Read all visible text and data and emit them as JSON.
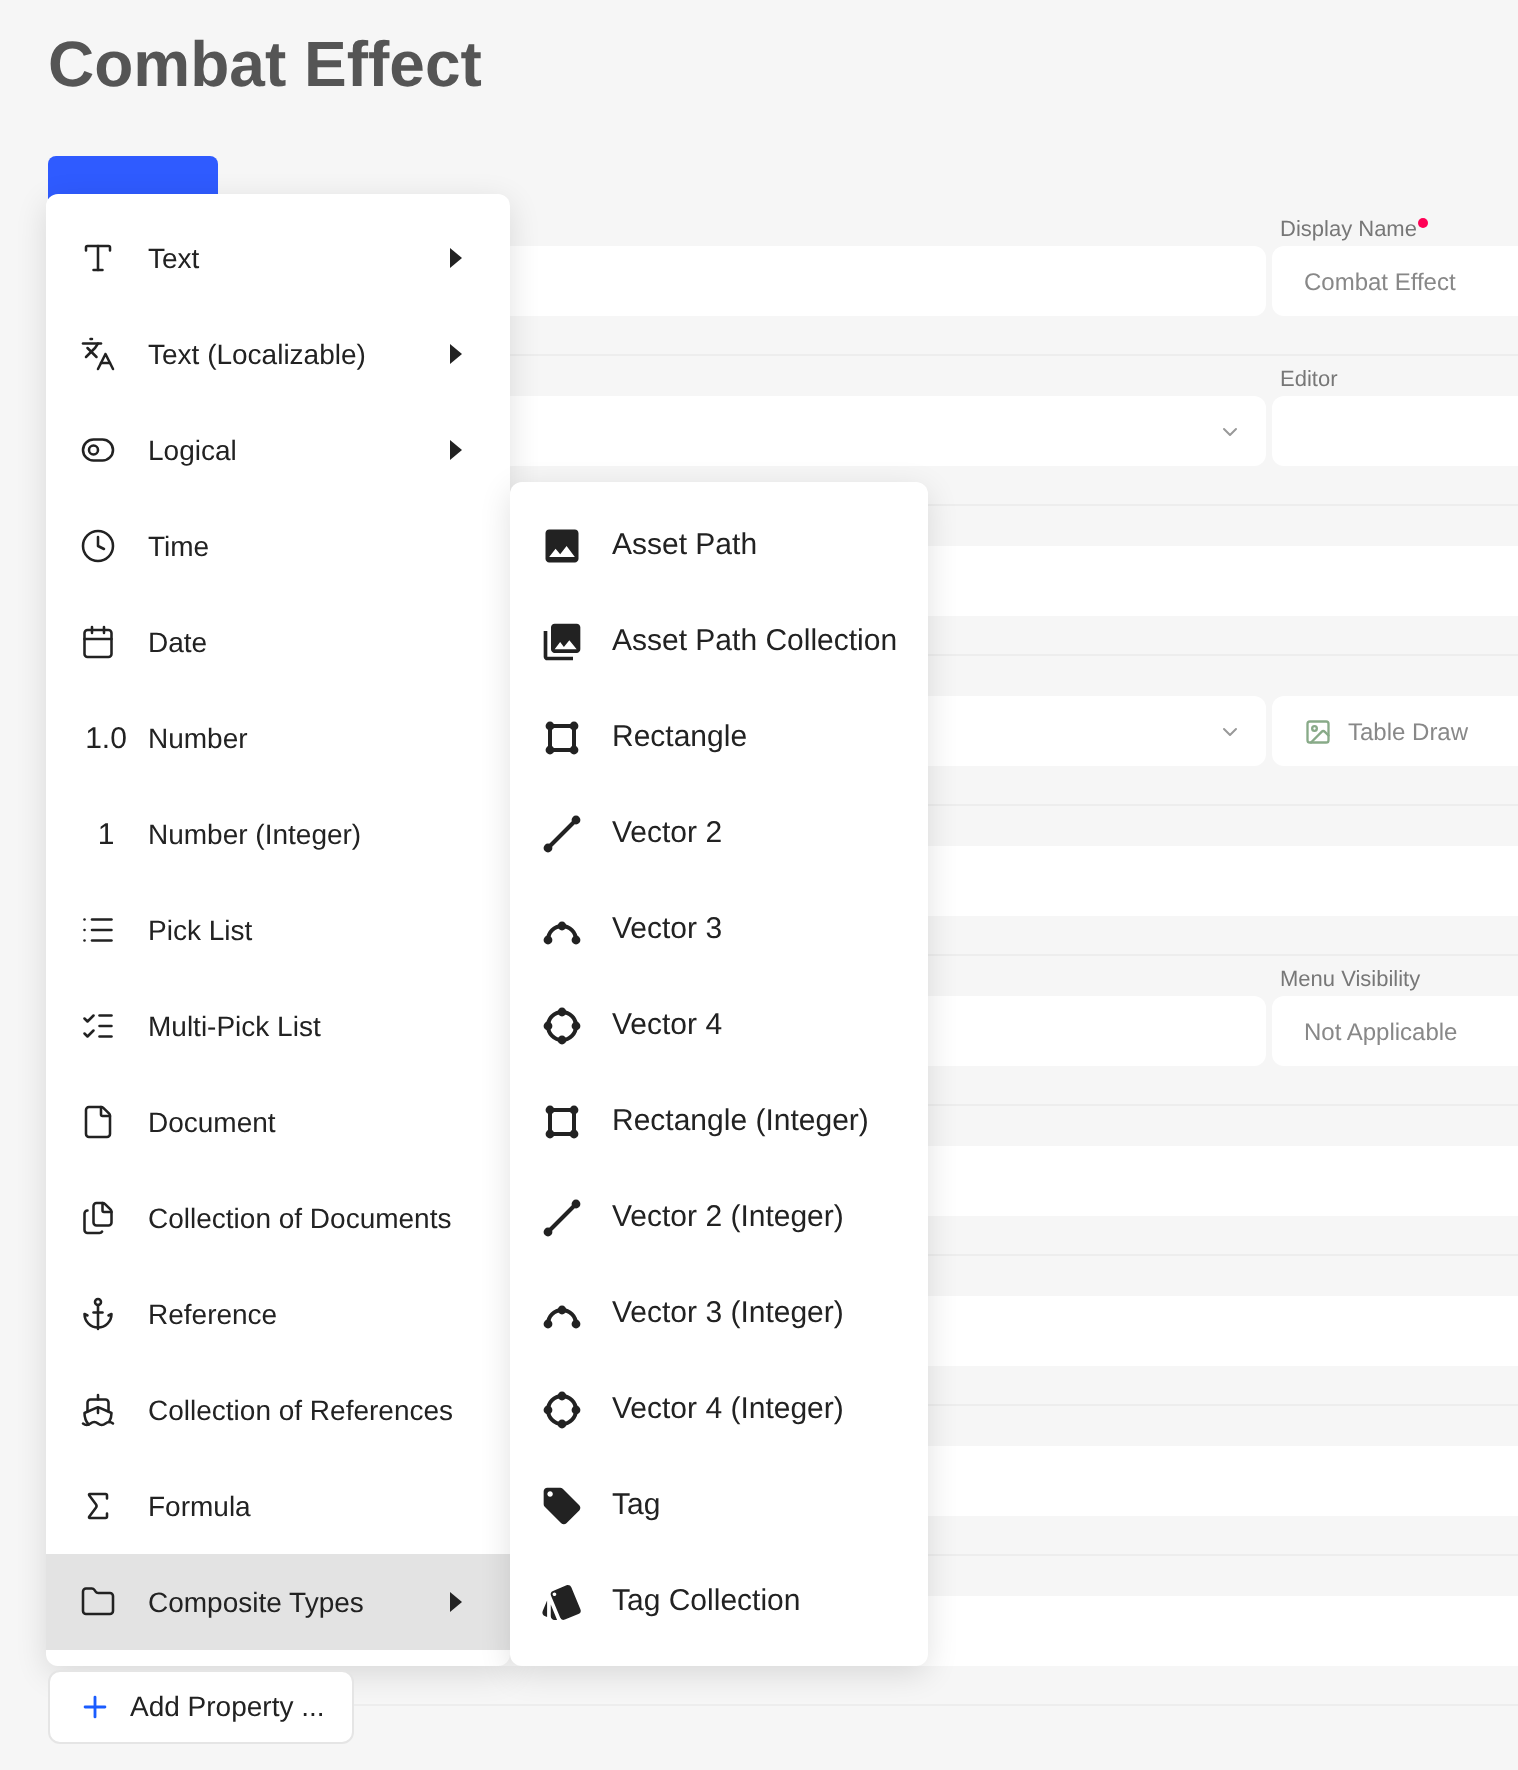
{
  "page": {
    "title": "Combat Effect"
  },
  "form": {
    "rows": [
      {
        "kind": "pair",
        "label": "Display Name",
        "required": true,
        "value": "Combat Effect",
        "left_dropdown": false
      },
      {
        "kind": "pair",
        "label": "Editor",
        "required": false,
        "value": "",
        "left_dropdown": true
      },
      {
        "kind": "full"
      },
      {
        "kind": "pair",
        "label": "",
        "required": false,
        "value": "Table Draw",
        "left_dropdown": true
      },
      {
        "kind": "full"
      },
      {
        "kind": "pair",
        "label": "Menu Visibility",
        "required": false,
        "value": "Not Applicable",
        "left_dropdown": false
      },
      {
        "kind": "full"
      },
      {
        "kind": "full"
      },
      {
        "kind": "full"
      },
      {
        "kind": "full"
      }
    ]
  },
  "menu": {
    "items": [
      {
        "label": "Text",
        "has_submenu": true,
        "selected": false
      },
      {
        "label": "Text (Localizable)",
        "has_submenu": true,
        "selected": false
      },
      {
        "label": "Logical",
        "has_submenu": true,
        "selected": false
      },
      {
        "label": "Time",
        "has_submenu": false,
        "selected": false
      },
      {
        "label": "Date",
        "has_submenu": false,
        "selected": false
      },
      {
        "label": "Number",
        "glyph": "1.0",
        "has_submenu": false,
        "selected": false
      },
      {
        "label": "Number (Integer)",
        "glyph": "1",
        "has_submenu": false,
        "selected": false
      },
      {
        "label": "Pick List",
        "has_submenu": false,
        "selected": false
      },
      {
        "label": "Multi-Pick List",
        "has_submenu": false,
        "selected": false
      },
      {
        "label": "Document",
        "has_submenu": false,
        "selected": false
      },
      {
        "label": "Collection of Documents",
        "has_submenu": false,
        "selected": false
      },
      {
        "label": "Reference",
        "has_submenu": false,
        "selected": false
      },
      {
        "label": "Collection of References",
        "has_submenu": false,
        "selected": false
      },
      {
        "label": "Formula",
        "has_submenu": false,
        "selected": false
      },
      {
        "label": "Composite Types",
        "has_submenu": true,
        "selected": true
      }
    ]
  },
  "submenu": {
    "items": [
      {
        "label": "Asset Path"
      },
      {
        "label": "Asset Path Collection"
      },
      {
        "label": "Rectangle"
      },
      {
        "label": "Vector 2"
      },
      {
        "label": "Vector 3"
      },
      {
        "label": "Vector 4"
      },
      {
        "label": "Rectangle (Integer)"
      },
      {
        "label": "Vector 2 (Integer)"
      },
      {
        "label": "Vector 3 (Integer)"
      },
      {
        "label": "Vector 4 (Integer)"
      },
      {
        "label": "Tag"
      },
      {
        "label": "Tag Collection"
      }
    ]
  },
  "add_property_button": {
    "label": "Add Property ..."
  }
}
